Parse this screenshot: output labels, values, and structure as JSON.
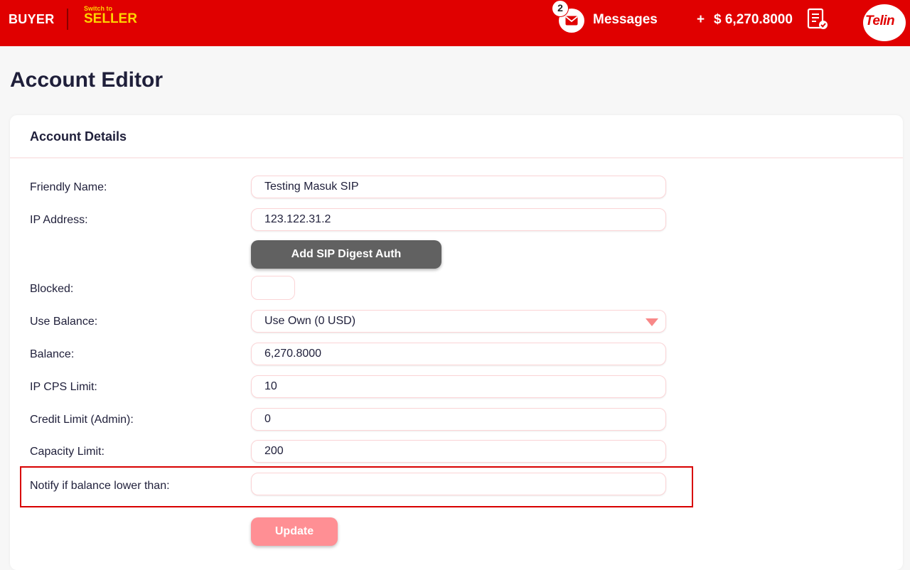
{
  "header": {
    "buyer_label": "BUYER",
    "switch_to_label": "Switch to",
    "seller_label": "SELLER",
    "messages_count": "2",
    "messages_label": "Messages",
    "plus_label": "+",
    "balance": "$ 6,270.8000",
    "logo_text": "Telin"
  },
  "page": {
    "title": "Account Editor"
  },
  "card": {
    "title": "Account Details",
    "fields": {
      "friendly_name": {
        "label": "Friendly Name:",
        "value": "Testing Masuk SIP"
      },
      "ip_address": {
        "label": "IP Address:",
        "value": "123.122.31.2"
      },
      "add_sip_button": "Add SIP Digest Auth",
      "blocked": {
        "label": "Blocked:"
      },
      "use_balance": {
        "label": "Use Balance:",
        "value": "Use Own (0 USD)"
      },
      "balance": {
        "label": "Balance:",
        "value": "6,270.8000"
      },
      "ip_cps_limit": {
        "label": "IP CPS Limit:",
        "value": "10"
      },
      "credit_limit": {
        "label": "Credit Limit (Admin):",
        "value": "0"
      },
      "capacity_limit": {
        "label": "Capacity Limit:",
        "value": "200"
      },
      "notify_balance": {
        "label": "Notify if balance lower than:",
        "value": ""
      }
    },
    "update_button": "Update"
  },
  "colors": {
    "header_bg": "#e00000",
    "seller_accent": "#ffd400",
    "highlight_border": "#d80000",
    "update_button_bg": "#ff8f94",
    "sip_button_bg": "#616161"
  }
}
